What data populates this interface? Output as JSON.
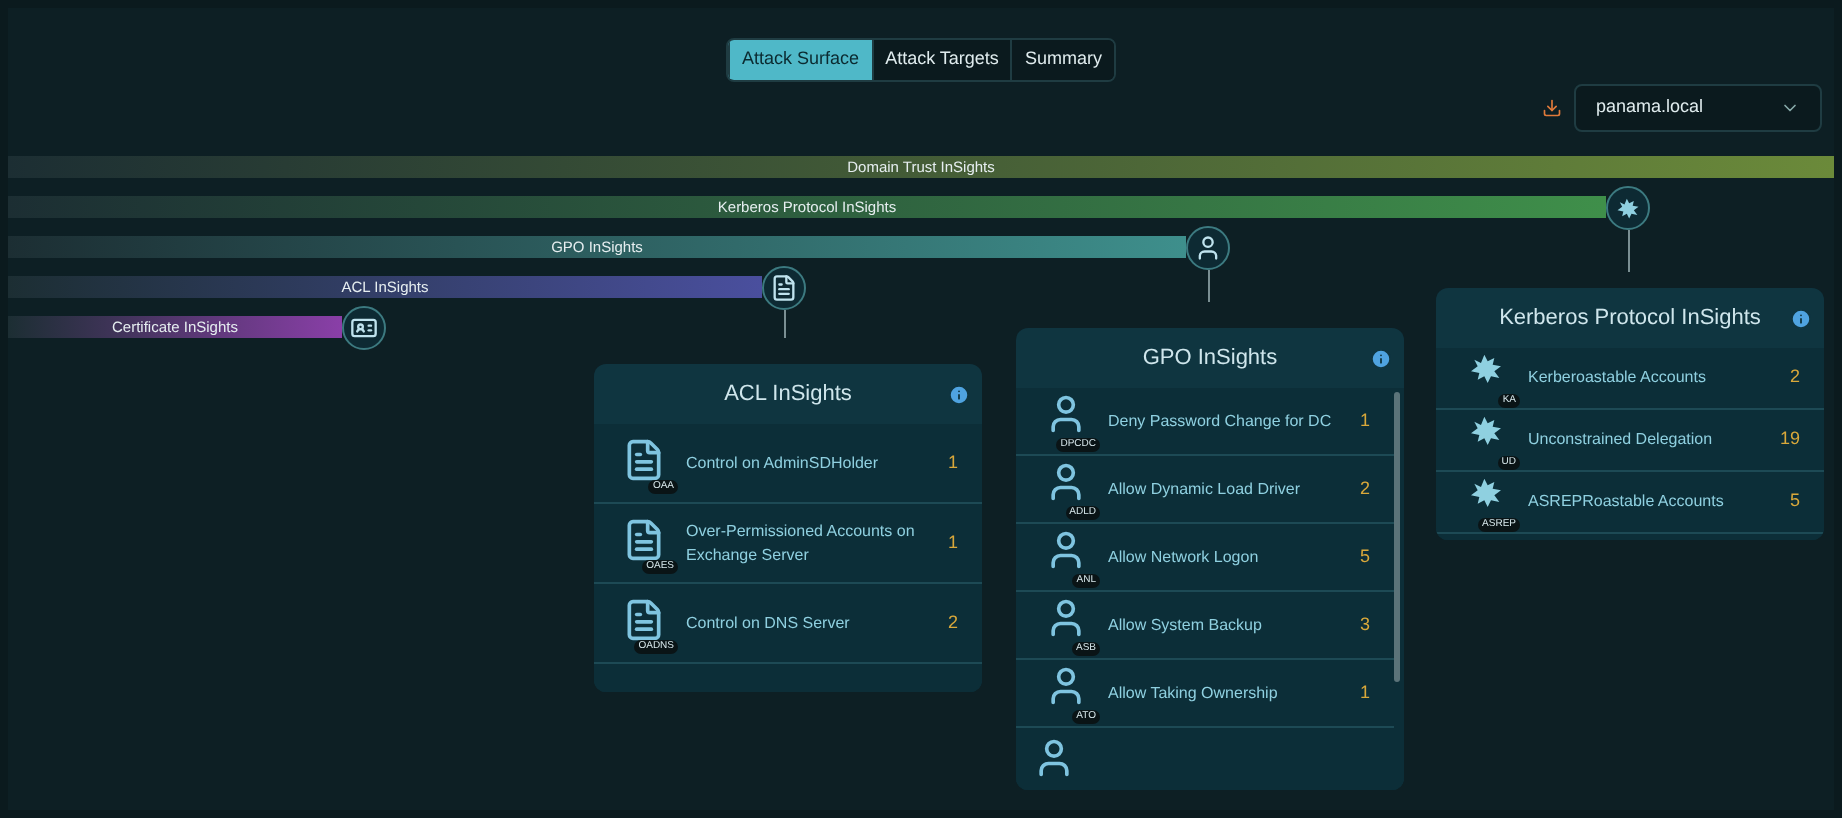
{
  "tabs": [
    {
      "label": "Attack Surface",
      "selected": true
    },
    {
      "label": "Attack Targets",
      "selected": false
    },
    {
      "label": "Summary",
      "selected": false
    }
  ],
  "domain_select": {
    "value": "panama.local"
  },
  "bars": [
    {
      "label": "Domain Trust InSights",
      "color": "#6b8a3a",
      "kind": "none"
    },
    {
      "label": "Kerberos Protocol InSights",
      "color": "#3f8f4a",
      "kind": "kerberos"
    },
    {
      "label": "GPO InSights",
      "color": "#3e8f8c",
      "kind": "gpo"
    },
    {
      "label": "ACL InSights",
      "color": "#4a4f9e",
      "kind": "acl"
    },
    {
      "label": "Certificate InSights",
      "color": "#8a3fa8",
      "kind": "certificate"
    }
  ],
  "cards": [
    {
      "title": "ACL InSights",
      "kind": "acl",
      "rows": [
        {
          "label": "Control on AdminSDHolder",
          "badge": "OAA",
          "count": "1"
        },
        {
          "label": "Over-Permissioned Accounts on Exchange Server",
          "badge": "OAES",
          "count": "1"
        },
        {
          "label": "Control on DNS Server",
          "badge": "OADNS",
          "count": "2"
        }
      ]
    },
    {
      "title": "GPO InSights",
      "kind": "gpo",
      "rows": [
        {
          "label": "Deny Password Change for DC",
          "badge": "DPCDC",
          "count": "1"
        },
        {
          "label": "Allow Dynamic Load Driver",
          "badge": "ADLD",
          "count": "2"
        },
        {
          "label": "Allow Network Logon",
          "badge": "ANL",
          "count": "5"
        },
        {
          "label": "Allow System Backup",
          "badge": "ASB",
          "count": "3"
        },
        {
          "label": "Allow Taking Ownership",
          "badge": "ATO",
          "count": "1"
        }
      ]
    },
    {
      "title": "Kerberos Protocol InSights",
      "kind": "kerberos",
      "rows": [
        {
          "label": "Kerberoastable Accounts",
          "badge": "KA",
          "count": "2"
        },
        {
          "label": "Unconstrained Delegation",
          "badge": "UD",
          "count": "19"
        },
        {
          "label": "ASREPRoastable Accounts",
          "badge": "ASREP",
          "count": "5"
        }
      ]
    }
  ]
}
